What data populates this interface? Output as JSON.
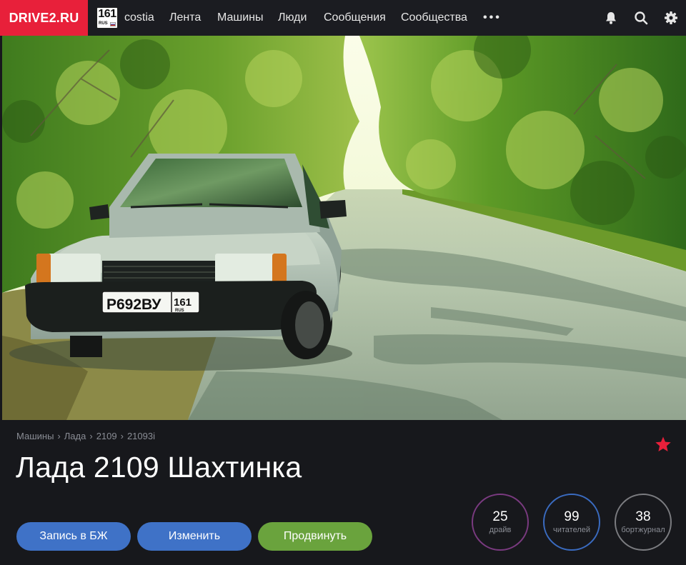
{
  "header": {
    "logo": "DRIVE2.RU",
    "region": {
      "number": "161",
      "country": "RUS"
    },
    "username": "costia",
    "nav": [
      "Лента",
      "Машины",
      "Люди",
      "Сообщения",
      "Сообщества"
    ],
    "more": "•••",
    "icons": [
      "bell-icon",
      "search-icon",
      "gear-icon"
    ]
  },
  "cover": {
    "plate": {
      "number": "Р692ВУ",
      "region": "161",
      "country": "RUS"
    }
  },
  "breadcrumb": [
    "Машины",
    "Лада",
    "2109",
    "21093i"
  ],
  "title": "Лада 2109 Шахтинка",
  "buttons": {
    "log": "Запись в БЖ",
    "edit": "Изменить",
    "promote": "Продвинуть"
  },
  "stats": {
    "drives": {
      "value": "25",
      "label": "драйв"
    },
    "readers": {
      "value": "99",
      "label": "читателей"
    },
    "logbook": {
      "value": "38",
      "label": "бортжурнал"
    }
  },
  "colors": {
    "brand": "#e8203a",
    "primary_button": "#3f72c7",
    "promote_button": "#6aa33d",
    "favorite_star": "#e8203a"
  }
}
